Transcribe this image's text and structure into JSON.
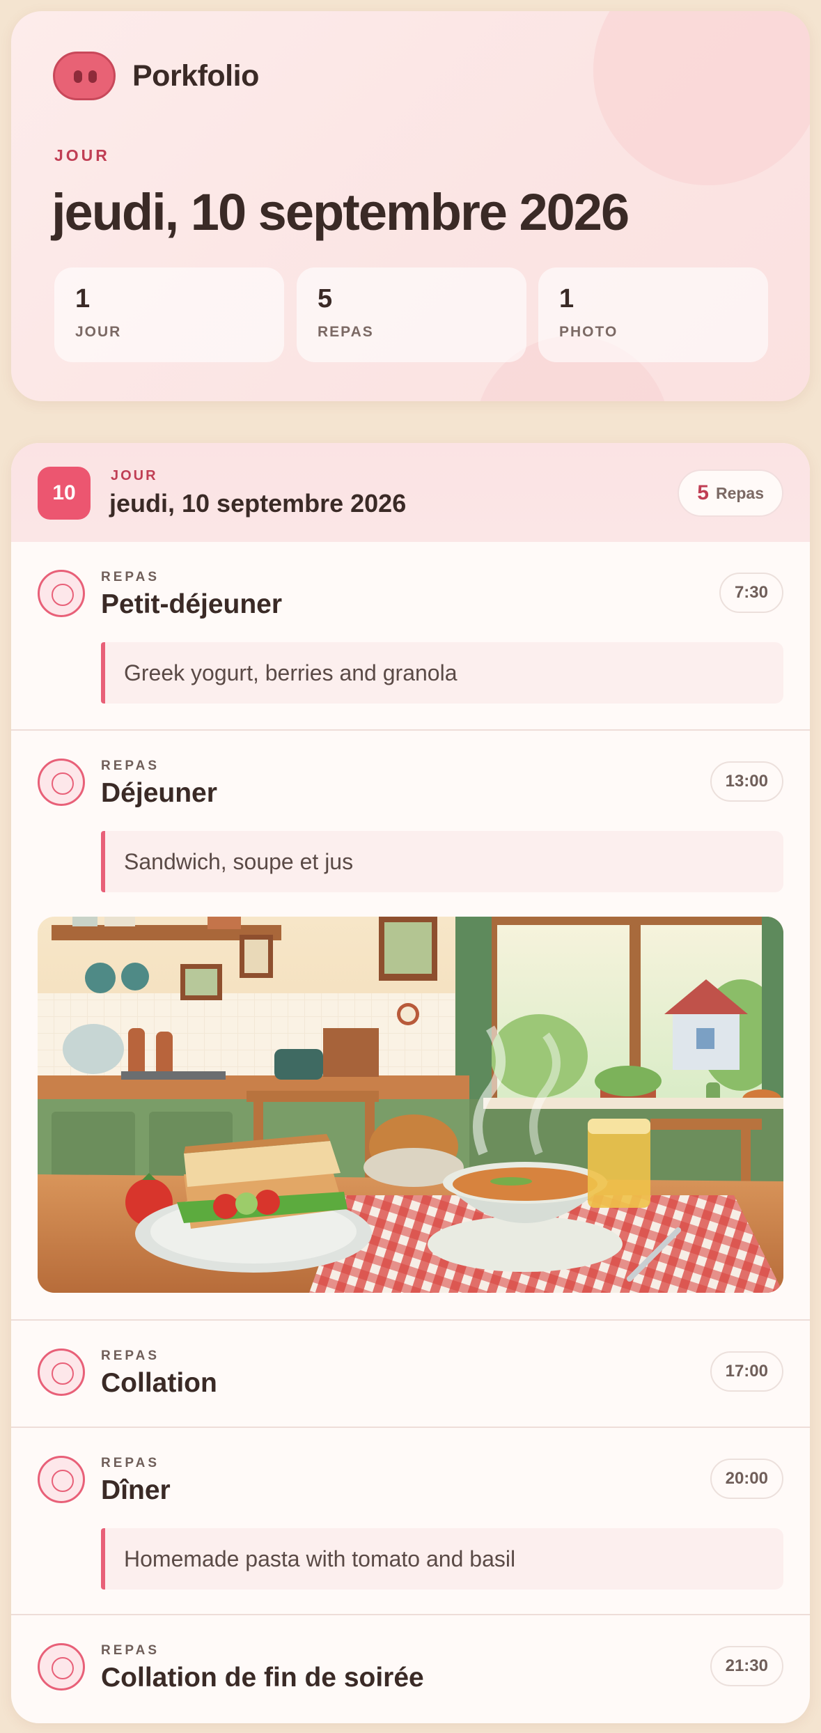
{
  "brand": {
    "name": "Porkfolio",
    "logo_icon": "pig-nose-icon"
  },
  "hero": {
    "eyebrow": "JOUR",
    "date": "jeudi, 10 septembre 2026",
    "stats": [
      {
        "value": "1",
        "label": "JOUR"
      },
      {
        "value": "5",
        "label": "REPAS"
      },
      {
        "value": "1",
        "label": "PHOTO"
      }
    ]
  },
  "day": {
    "badge": "10",
    "eyebrow": "JOUR",
    "title": "jeudi, 10 septembre 2026",
    "meal_count": "5",
    "meal_count_label": "Repas",
    "meals": [
      {
        "eyebrow": "REPAS",
        "title": "Petit-déjeuner",
        "time": "7:30",
        "note": "Greek yogurt, berries and granola"
      },
      {
        "eyebrow": "REPAS",
        "title": "Déjeuner",
        "time": "13:00",
        "note": "Sandwich, soupe et jus"
      },
      {
        "eyebrow": "REPAS",
        "title": "Collation",
        "time": "17:00"
      },
      {
        "eyebrow": "REPAS",
        "title": "Dîner",
        "time": "20:00",
        "note": "Homemade pasta with tomato and basil"
      },
      {
        "eyebrow": "REPAS",
        "title": "Collation de fin de soirée",
        "time": "21:30"
      }
    ]
  },
  "colors": {
    "accent": "#ec5670",
    "background": "#f4e4d0",
    "text": "#3a2a26"
  }
}
